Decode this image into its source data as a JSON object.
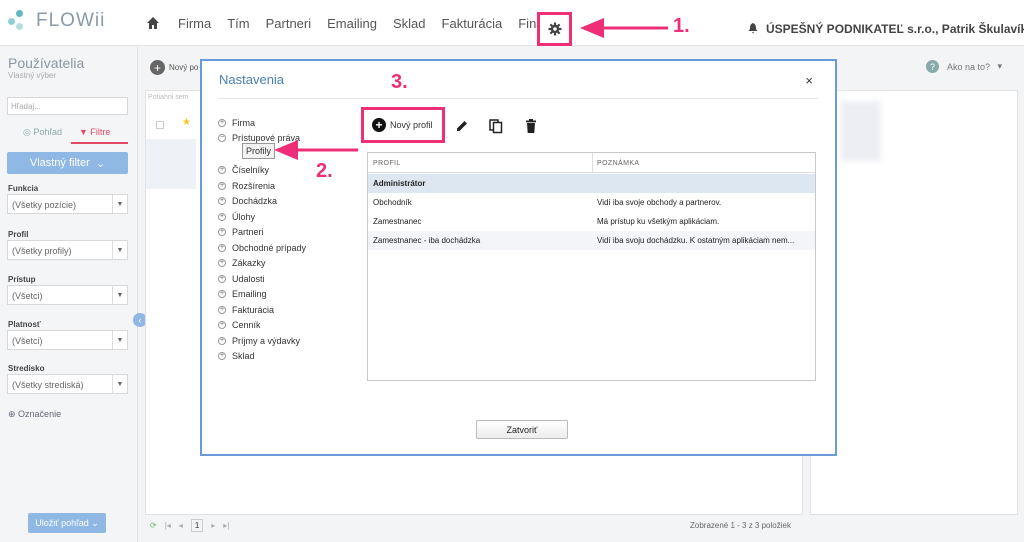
{
  "app": {
    "logo": "FLOWii"
  },
  "nav": {
    "items": [
      "Firma",
      "Tím",
      "Partneri",
      "Emailing",
      "Sklad",
      "Fakturácia",
      "Financie"
    ]
  },
  "company": "ÚSPEŠNÝ PODNIKATEĽ s.r.o., Patrik Škulavík",
  "sidebar": {
    "title": "Používatelia",
    "subtitle": "Vlastný výber",
    "search_placeholder": "Hľadaj...",
    "tab_view": "Pohľad",
    "tab_filters": "Filtre",
    "custom_filter": "Vlastný filter",
    "filters": [
      {
        "label": "Funkcia",
        "value": "(Všetky pozície)"
      },
      {
        "label": "Profil",
        "value": "(Všetky profily)"
      },
      {
        "label": "Prístup",
        "value": "(Všetci)"
      },
      {
        "label": "Platnosť",
        "value": "(Všetci)"
      },
      {
        "label": "Stredisko",
        "value": "(Všetky strediská)"
      }
    ],
    "tag": "Označenie",
    "save_view": "Uložiť pohľad"
  },
  "background": {
    "new_user": "Nový po",
    "help": "Ako na to?",
    "footer": "Zobrazené 1 - 3 z 3 položiek",
    "page": "1",
    "search_hint": "Potiahni sem"
  },
  "modal": {
    "title": "Nastavenia",
    "close": "×",
    "tree": [
      "Firma",
      "Prístupové práva",
      "Číselníky",
      "Rozšírenia",
      "Dochádzka",
      "Úlohy",
      "Partneri",
      "Obchodné prípady",
      "Zákazky",
      "Udalosti",
      "Emailing",
      "Fakturácia",
      "Cenník",
      "Príjmy a výdavky",
      "Sklad"
    ],
    "tree_child": "Profily",
    "new_profile": "Nový profil",
    "columns": [
      "PROFIL",
      "POZNÁMKA"
    ],
    "rows": [
      {
        "profile": "Administrátor",
        "note": ""
      },
      {
        "profile": "Obchodník",
        "note": "Vidí iba svoje obchody a partnerov."
      },
      {
        "profile": "Zamestnanec",
        "note": "Má prístup ku všetkým aplikáciam."
      },
      {
        "profile": "Zamestnanec - iba dochádzka",
        "note": "Vidí iba svoju dochádzku. K ostatným aplikáciam nem..."
      }
    ],
    "close_button": "Zatvoriť"
  },
  "annotations": [
    "1.",
    "2.",
    "3."
  ],
  "colors": {
    "accent": "#ee2f78",
    "primary": "#4a7fb5",
    "button": "#8fb8e5"
  }
}
